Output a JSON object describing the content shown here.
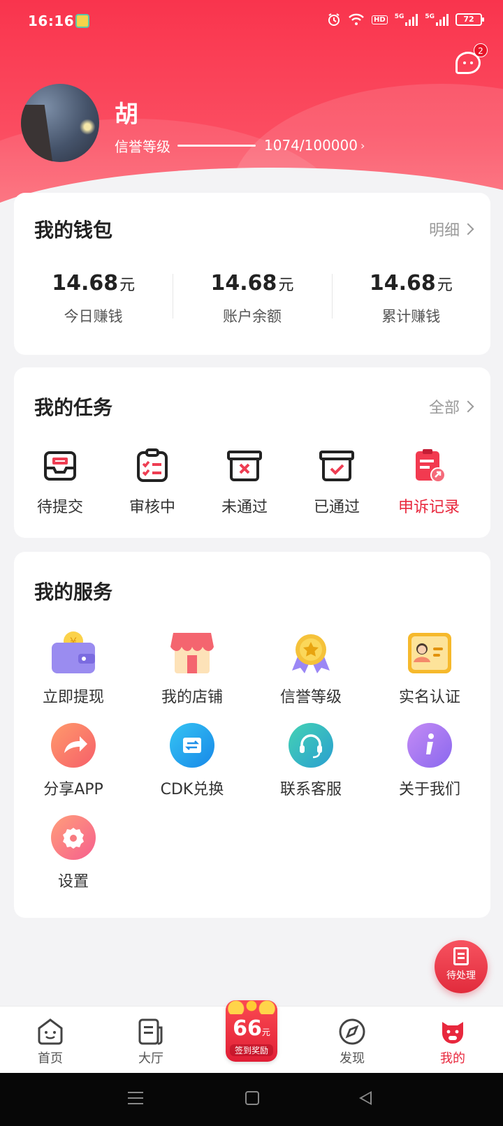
{
  "status_bar": {
    "time": "16:16",
    "battery": "72",
    "network": "5G",
    "hd": "HD"
  },
  "header": {
    "username": "胡",
    "credit_label": "信誉等级",
    "credit_value": "1074/100000",
    "message_badge": "2"
  },
  "wallet": {
    "title": "我的钱包",
    "more_label": "明细",
    "unit": "元",
    "stats": [
      {
        "value": "14.68",
        "label": "今日赚钱"
      },
      {
        "value": "14.68",
        "label": "账户余额"
      },
      {
        "value": "14.68",
        "label": "累计赚钱"
      }
    ]
  },
  "tasks": {
    "title": "我的任务",
    "more_label": "全部",
    "items": [
      {
        "label": "待提交",
        "icon": "inbox-icon"
      },
      {
        "label": "审核中",
        "icon": "clipboard-check-icon"
      },
      {
        "label": "未通过",
        "icon": "box-x-icon"
      },
      {
        "label": "已通过",
        "icon": "box-check-icon"
      },
      {
        "label": "申诉记录",
        "icon": "appeal-record-icon"
      }
    ]
  },
  "services": {
    "title": "我的服务",
    "items": [
      {
        "label": "立即提现",
        "icon": "wallet-icon"
      },
      {
        "label": "我的店铺",
        "icon": "store-icon"
      },
      {
        "label": "信誉等级",
        "icon": "medal-icon"
      },
      {
        "label": "实名认证",
        "icon": "id-card-icon"
      },
      {
        "label": "分享APP",
        "icon": "share-icon"
      },
      {
        "label": "CDK兑换",
        "icon": "ticket-exchange-icon"
      },
      {
        "label": "联系客服",
        "icon": "headset-icon"
      },
      {
        "label": "关于我们",
        "icon": "info-icon"
      },
      {
        "label": "设置",
        "icon": "settings-icon"
      }
    ]
  },
  "fab": {
    "label": "待处理"
  },
  "tabbar": {
    "tabs": [
      {
        "label": "首页",
        "icon": "home-face-icon"
      },
      {
        "label": "大厅",
        "icon": "hall-doc-icon"
      },
      {
        "label": "发现",
        "icon": "compass-icon"
      },
      {
        "label": "我的",
        "icon": "pig-mine-icon"
      }
    ],
    "signin": {
      "number": "66",
      "unit": "元",
      "label": "签到奖励"
    }
  },
  "colors": {
    "brand": "#f93a4f",
    "active": "#e8283d",
    "background": "#f3f3f5"
  }
}
